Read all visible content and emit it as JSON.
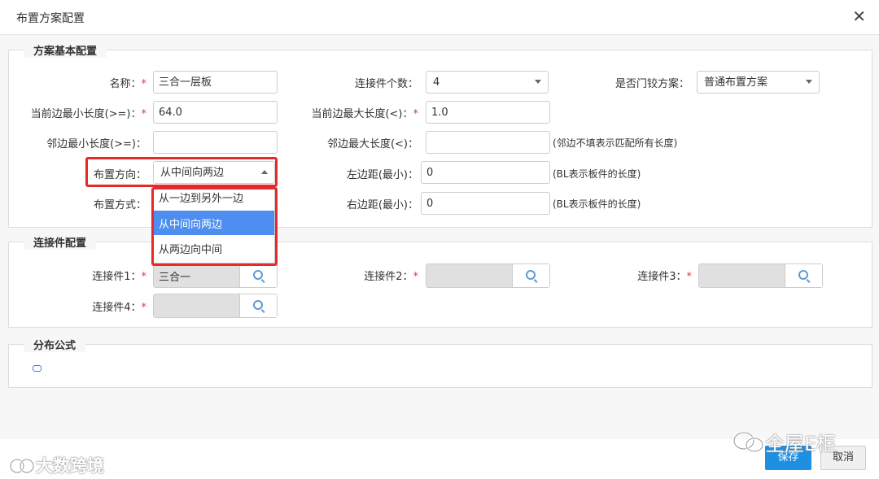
{
  "dialog": {
    "title": "布置方案配置",
    "close_glyph": "✕"
  },
  "basic": {
    "legend": "方案基本配置",
    "name": {
      "label": "名称：",
      "required": "*",
      "value": "三合一层板"
    },
    "connector_count": {
      "label": "连接件个数：",
      "value": "4"
    },
    "hinge": {
      "label": "是否门铰方案：",
      "value": "普通布置方案"
    },
    "cur_min": {
      "label": "当前边最小长度(>=)：",
      "required": "*",
      "value": "64.0"
    },
    "cur_max": {
      "label": "当前边最大长度(<)：",
      "required": "*",
      "value": "1.0"
    },
    "adj_min": {
      "label": "邻边最小长度(>=)：",
      "value": ""
    },
    "adj_max": {
      "label": "邻边最大长度(<)：",
      "value": "",
      "hint": "(邻边不填表示匹配所有长度)"
    },
    "direction": {
      "label": "布置方向：",
      "value": "从中间向两边"
    },
    "left_margin": {
      "label": "左边距(最小)：",
      "value": "0",
      "hint": "(BL表示板件的长度)"
    },
    "mode": {
      "label": "布置方式："
    },
    "right_margin": {
      "label": "右边距(最小)：",
      "value": "0",
      "hint": "(BL表示板件的长度)"
    }
  },
  "direction_options": [
    "从一边到另外一边",
    "从中间向两边",
    "从两边向中间"
  ],
  "connectors": {
    "legend": "连接件配置",
    "items": [
      {
        "label": "连接件1：",
        "required": "*",
        "value": "三合一"
      },
      {
        "label": "连接件2：",
        "required": "*",
        "value": ""
      },
      {
        "label": "连接件3：",
        "required": "*",
        "value": ""
      },
      {
        "label": "连接件4：",
        "required": "*",
        "value": ""
      }
    ]
  },
  "formula": {
    "legend": "分布公式"
  },
  "footer": {
    "save": "保存",
    "cancel": "取消"
  },
  "watermarks": {
    "left": "大数跨境",
    "right": "全屋E柜"
  },
  "colors": {
    "primary": "#1e8fe1",
    "selected_option": "#4d8ef0",
    "highlight": "#e32b2b",
    "required": "#e4393c"
  }
}
